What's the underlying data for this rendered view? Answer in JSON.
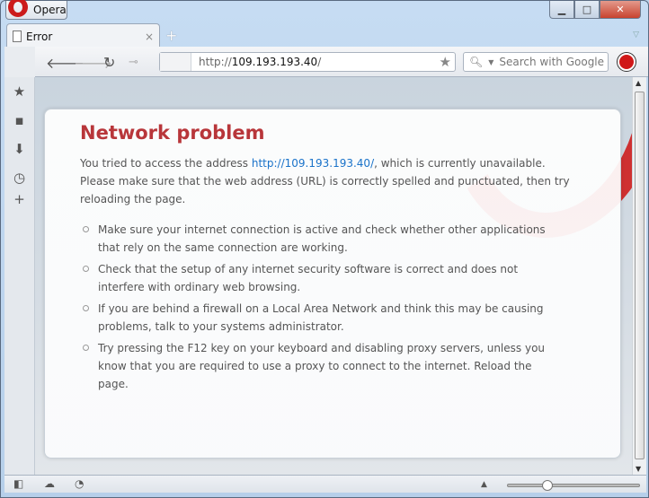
{
  "window": {
    "app_button": "Opera",
    "minimize": "▁",
    "maximize": "□",
    "close": "✕"
  },
  "tabs": [
    {
      "label": "Error",
      "close": "×"
    }
  ],
  "new_tab": "+",
  "toolbar": {
    "address_protocol": "http://",
    "address_host": "109.193.193.40",
    "address_trail": "/",
    "search_placeholder": "Search with Google"
  },
  "page": {
    "title": "Network problem",
    "intro_before": "You tried to access the address ",
    "intro_link": "http://109.193.193.40/",
    "intro_after": ", which is currently unavailable. Please make sure that the web address (URL) is correctly spelled and punctuated, then try reloading the page.",
    "tips": [
      "Make sure your internet connection is active and check whether other applications that rely on the same connection are working.",
      "Check that the setup of any internet security software is correct and does not interfere with ordinary web browsing.",
      "If you are behind a firewall on a Local Area Network and think this may be causing problems, talk to your systems administrator.",
      "Try pressing the F12 key on your keyboard and disabling proxy servers, unless you know that you are required to use a proxy to connect to the internet. Reload the page."
    ]
  },
  "statusbar": {
    "zoom_level_fraction": 0.3
  },
  "colors": {
    "title": "#b8363a",
    "link": "#1a73c9",
    "brand": "#cc1b1b"
  }
}
